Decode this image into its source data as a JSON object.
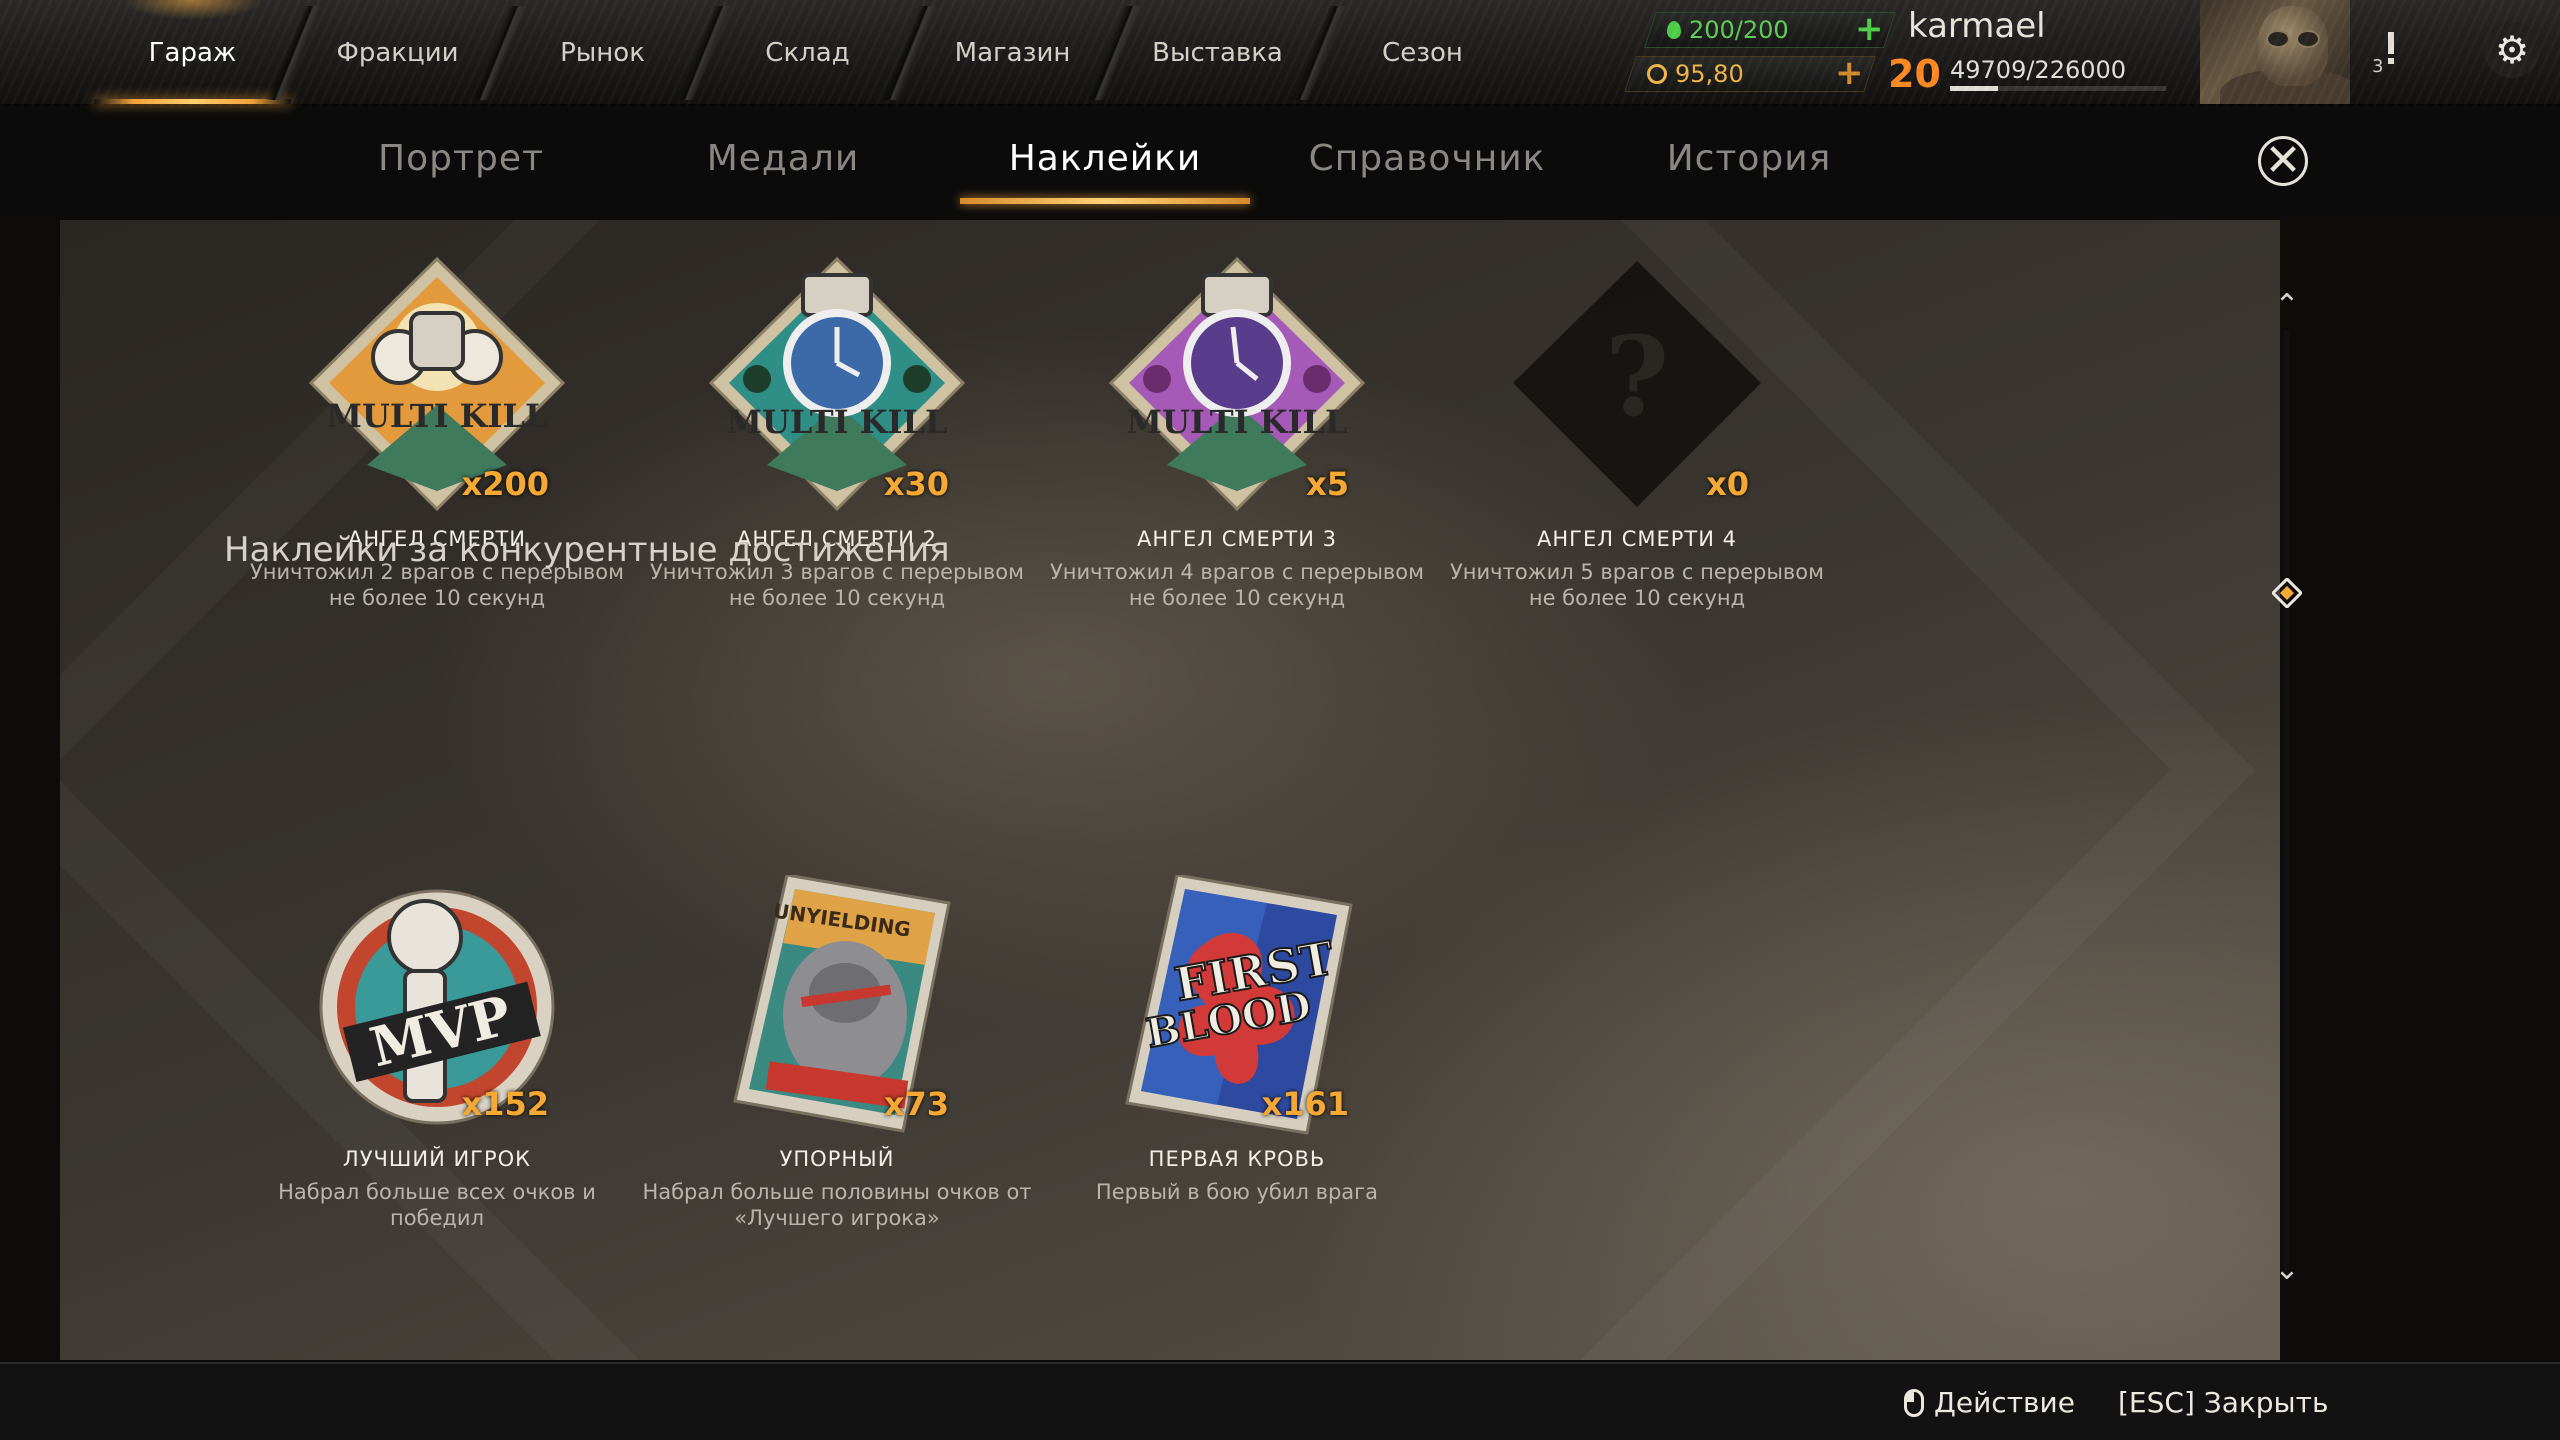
{
  "main_nav": [
    {
      "label": "Гараж",
      "active": true
    },
    {
      "label": "Фракции",
      "active": false
    },
    {
      "label": "Рынок",
      "active": false
    },
    {
      "label": "Склад",
      "active": false
    },
    {
      "label": "Магазин",
      "active": false
    },
    {
      "label": "Выставка",
      "active": false
    },
    {
      "label": "Сезон",
      "active": false
    }
  ],
  "player": {
    "fuel": "200/200",
    "coins": "95,80",
    "name": "karmael",
    "level": "20",
    "xp": "49709/226000",
    "xp_fraction": 0.22,
    "notifications": "3"
  },
  "sub_nav": [
    {
      "label": "Портрет",
      "active": false
    },
    {
      "label": "Медали",
      "active": false
    },
    {
      "label": "Наклейки",
      "active": true
    },
    {
      "label": "Справочник",
      "active": false
    },
    {
      "label": "История",
      "active": false
    }
  ],
  "row1": [
    {
      "title": "АНГЕЛ СМЕРТИ",
      "count": "x200",
      "desc": "Уничтожил 2 врагов с перерывом не более 10 секунд",
      "icon": "multi-kill-orange-sticker"
    },
    {
      "title": "АНГЕЛ СМЕРТИ 2",
      "count": "x30",
      "desc": "Уничтожил 3 врагов с перерывом не более 10 секунд",
      "icon": "multi-kill-teal-sticker"
    },
    {
      "title": "АНГЕЛ СМЕРТИ 3",
      "count": "x5",
      "desc": "Уничтожил 4 врагов с перерывом не более 10 секунд",
      "icon": "multi-kill-purple-sticker"
    },
    {
      "title": "АНГЕЛ СМЕРТИ 4",
      "count": "x0",
      "desc": "Уничтожил 5 врагов с перерывом не более 10 секунд",
      "icon": "locked-sticker"
    }
  ],
  "section_title": "Наклейки за конкурентные достижения",
  "row2": [
    {
      "title": "ЛУЧШИЙ ИГРОК",
      "count": "x152",
      "desc": "Набрал больше всех очков и победил",
      "icon": "mvp-sticker"
    },
    {
      "title": "УПОРНЫЙ",
      "count": "x73",
      "desc": "Набрал больше половины очков от «Лучшего игрока»",
      "icon": "unyielding-sticker"
    },
    {
      "title": "ПЕРВАЯ КРОВЬ",
      "count": "x161",
      "desc": "Первый в бою убил врага",
      "icon": "first-blood-sticker"
    }
  ],
  "sticker_texts": {
    "multi_kill": "MULTI KILL",
    "mvp": "MVP",
    "unyielding": "UNYIELDING",
    "first_blood_1": "FIRST",
    "first_blood_2": "BLOOD"
  },
  "bottom": {
    "action": "Действие",
    "close": "[ESC] Закрыть"
  },
  "colors": {
    "accent_orange": "#f5a833",
    "fuel_green": "#5fd15a",
    "level_orange": "#ff8a24"
  }
}
